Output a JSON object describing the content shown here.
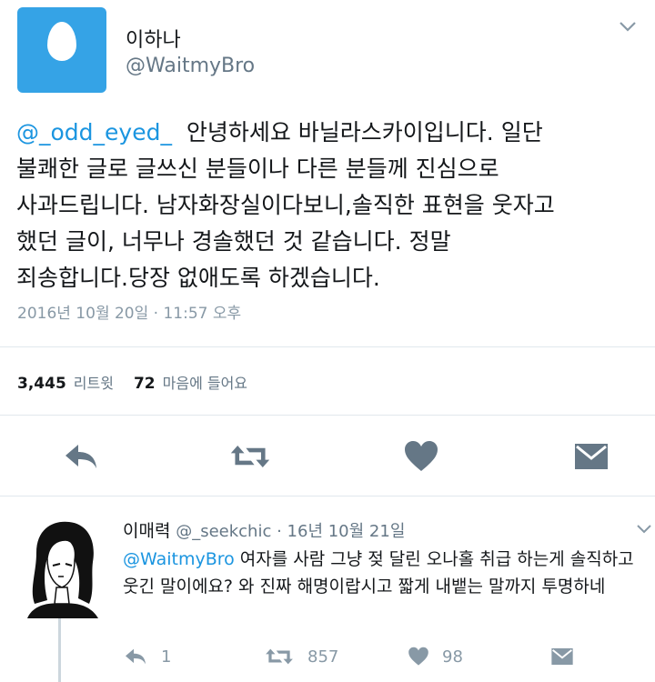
{
  "tweet": {
    "display_name": "이하나",
    "handle": "@WaitmyBro",
    "mention": "@_odd_eyed_",
    "text": "  안녕하세요 바닐라스카이입니다. 일단\n불쾌한 글로 글쓰신 분들이나 다른 분들께 진심으로\n사과드립니다. 남자화장실이다보니,솔직한 표현을 웃자고\n했던 글이, 너무나 경솔했던 것 같습니다. 정말\n죄송합니다.당장 없애도록 하겠습니다.",
    "timestamp": "2016년 10월 20일 · 11:57 오후",
    "retweets_count": "3,445",
    "retweets_label": "리트윗",
    "likes_count": "72",
    "likes_label": "마음에 들어요",
    "actions": [
      "reply-icon",
      "retweet-icon",
      "heart-icon",
      "message-icon"
    ]
  },
  "reply": {
    "display_name": "이매력",
    "handle": "@_seekchic",
    "dot": "·",
    "time": "16년 10월 21일",
    "mention": "@WaitmyBro",
    "text": " 여자를 사람 그냥 젖 달린 오나홀 취급 하는게 솔직하고 웃긴 말이에요? 와 진짜 해명이랍시고 짧게 내뱉는 말까지 투명하네",
    "reply_count": "1",
    "retweet_count": "857",
    "like_count": "98"
  },
  "colors": {
    "accent": "#1b95e0",
    "avatar_bg": "#35a3e6",
    "icon": "#657786",
    "muted": "#8899a6"
  }
}
